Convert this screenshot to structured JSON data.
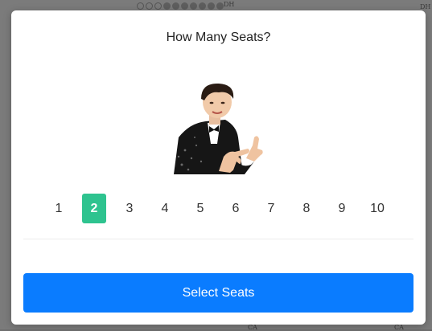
{
  "background": {
    "section_labels": [
      "DH",
      "DH",
      "CA",
      "CA"
    ]
  },
  "modal": {
    "title": "How Many Seats?",
    "illustration": {
      "icon": "performer-photo",
      "colors": {
        "jacket": "#1a1a1a",
        "skin": "#f0c9a8",
        "hair": "#2a1c14",
        "shirt": "#ffffff"
      }
    },
    "seat_counts": [
      "1",
      "2",
      "3",
      "4",
      "5",
      "6",
      "7",
      "8",
      "9",
      "10"
    ],
    "selected_count": "2",
    "cta_label": "Select Seats",
    "colors": {
      "selected": "#2ec38f",
      "cta": "#0a7cff"
    }
  }
}
